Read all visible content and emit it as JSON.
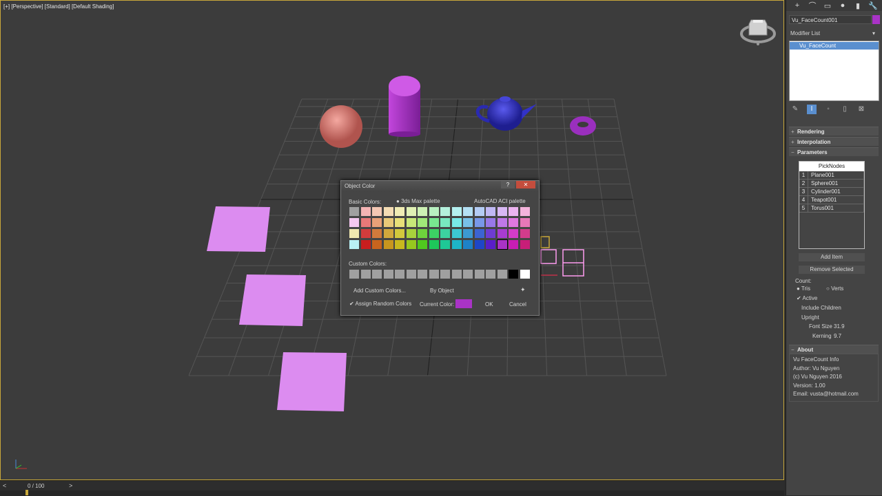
{
  "viewport": {
    "label": "[+] [Perspective] [Standard] [Default Shading]",
    "object_colors": {
      "sphere": "#e07a74",
      "cylinder": "#a933c6",
      "teapot": "#3232c8",
      "torus": "#9a2fbe",
      "planes": "#dc8cf0"
    }
  },
  "timeline": {
    "counter": "0 / 100",
    "prev": "<",
    "next": ">"
  },
  "panel": {
    "icons": [
      "+",
      "⌒",
      "▭",
      "●",
      "▮",
      "🔧"
    ],
    "object_name": "Vu_FaceCount001",
    "object_color": "#a933c6",
    "modifier_list_label": "Modifier List",
    "modifier_dropdown": "▾",
    "stack_item": "Vu_FaceCount",
    "stack_icons": [
      "✎",
      "I",
      "◦",
      "▯",
      "⊠"
    ],
    "rollouts": [
      "Rendering",
      "Interpolation",
      "Parameters",
      "About"
    ],
    "picknodes": {
      "header": "PickNodes",
      "rows": [
        {
          "n": "1",
          "name": "Plane001"
        },
        {
          "n": "2",
          "name": "Sphere001"
        },
        {
          "n": "3",
          "name": "Cylinder001"
        },
        {
          "n": "4",
          "name": "Teapot001"
        },
        {
          "n": "5",
          "name": "Torus001"
        }
      ]
    },
    "add_item": "Add Item",
    "remove_selected": "Remove Selected",
    "count_label": "Count:",
    "tris": "Tris",
    "verts": "Verts",
    "active": "Active",
    "include_children": "Include Children",
    "upright": "Upright",
    "font_size_label": "Font Size",
    "font_size_value": "31.9",
    "kerning_label": "Kerning",
    "kerning_value": "9.7",
    "about_lines": [
      "Vu FaceCount Info",
      "Author: Vu Nguyen",
      "(c) Vu Nguyen 2016",
      "Version: 1.00",
      "Email: vusta@hotmail.com"
    ]
  },
  "dialog": {
    "title": "Object Color",
    "help": "?",
    "close": "✕",
    "basic_colors_label": "Basic Colors:",
    "palette_3ds": "3ds Max palette",
    "palette_aci": "AutoCAD ACI palette",
    "basic_colors": [
      [
        "#a0a0a0",
        "#f4b4b4",
        "#f4c8b4",
        "#f4dcb4",
        "#f0ecb4",
        "#e0f0b4",
        "#cdf0b4",
        "#b8f0c0",
        "#b4f0dc",
        "#b4f0f0",
        "#b4e0f4",
        "#b4ccf4",
        "#c0b8f4",
        "#d8b8f4",
        "#ecb4f0",
        "#f4b4dc"
      ],
      [
        "#f4c8f0",
        "#e87878",
        "#e8a078",
        "#e8c878",
        "#e8e078",
        "#c8e878",
        "#a0e878",
        "#78e890",
        "#78e8c0",
        "#78e8e8",
        "#78c0e8",
        "#7898e8",
        "#9878e8",
        "#c078e8",
        "#e078e0",
        "#e878b8"
      ],
      [
        "#f0e8b0",
        "#d23c3c",
        "#d27a3c",
        "#d2a83c",
        "#d2c83c",
        "#a8d23c",
        "#6ed23c",
        "#3cd264",
        "#3cd2a0",
        "#3cc8d2",
        "#3c9ad2",
        "#3c64d2",
        "#6e3cd2",
        "#a83cd2",
        "#d23cc8",
        "#d23c8c"
      ],
      [
        "#b8f0f4",
        "#c81e1e",
        "#c8641e",
        "#c8961e",
        "#c8b81e",
        "#96c81e",
        "#50c81e",
        "#1ec85a",
        "#1ec896",
        "#1eb4c8",
        "#1e82c8",
        "#1e46c8",
        "#5a1ec8",
        "#a933c6",
        "#c81eb4",
        "#c81e78"
      ]
    ],
    "selected_swatch": "3.13",
    "custom_colors_label": "Custom Colors:",
    "custom_colors": [
      "#a0a0a0",
      "#a0a0a0",
      "#a0a0a0",
      "#a0a0a0",
      "#a0a0a0",
      "#a0a0a0",
      "#a0a0a0",
      "#a0a0a0",
      "#a0a0a0",
      "#a0a0a0",
      "#a0a0a0",
      "#a0a0a0",
      "#a0a0a0",
      "#a0a0a0",
      "#000000",
      "#ffffff"
    ],
    "add_custom": "Add Custom Colors...",
    "by_object": "By Object",
    "assign_random": "Assign Random Colors",
    "current_color_label": "Current Color:",
    "current_color": "#a933c6",
    "ok": "OK",
    "cancel": "Cancel"
  }
}
